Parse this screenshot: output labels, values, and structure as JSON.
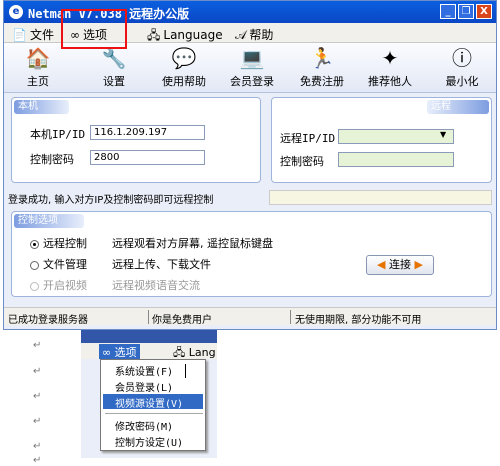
{
  "window": {
    "title": "Netman V7.038 远程办公版",
    "min": "_",
    "restore": "❐",
    "close": "X"
  },
  "menubar": {
    "file": "文件",
    "options": "选项",
    "language": "Language",
    "help": "帮助"
  },
  "toolbar": {
    "home": "主页",
    "settings": "设置",
    "use_help": "使用帮助",
    "member_login": "会员登录",
    "free_register": "免费注册",
    "recommend": "推荐他人",
    "minimize": "最小化"
  },
  "local_panel": {
    "header": "本机",
    "ip_label": "本机IP/ID",
    "ip_value": "116.1.209.197",
    "pwd_label": "控制密码",
    "pwd_value": "2800"
  },
  "remote_panel": {
    "header": "远程",
    "ip_label": "远程IP/ID",
    "ip_value": "",
    "pwd_label": "控制密码",
    "pwd_value": ""
  },
  "status_message": "登录成功, 输入对方IP及控制密码即可远程控制",
  "control_panel": {
    "header": "控制选项",
    "options": [
      {
        "label": "远程控制",
        "desc": "远程观看对方屏幕, 遥控鼠标键盘",
        "selected": true
      },
      {
        "label": "文件管理",
        "desc": "远程上传、下载文件",
        "selected": false
      },
      {
        "label": "开启视频",
        "desc": "远程视频语音交流",
        "selected": false
      }
    ],
    "connect_label": "连接"
  },
  "statusbar": {
    "server": "已成功登录服务器",
    "user": "你是免费用户",
    "expiry": "无使用期限, 部分功能不可用"
  },
  "dropdown": {
    "menu_label": "选项",
    "lang_fragment": "Lang",
    "items": [
      "系统设置(F)",
      "会员登录(L)",
      "视频源设置(V)",
      "修改密码(M)",
      "控制方设定(U)"
    ]
  },
  "para_marks": [
    "↵",
    "↵",
    "↵",
    "↵",
    "↵",
    "↵"
  ]
}
